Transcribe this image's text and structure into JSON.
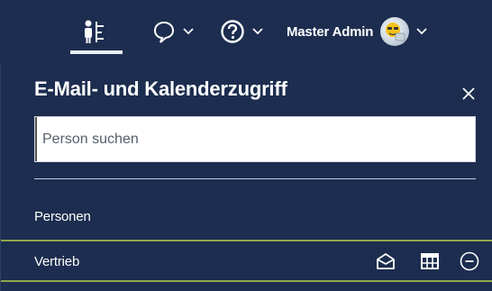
{
  "topbar": {
    "icons": [
      "people-directory-icon",
      "chat-bubble-icon",
      "help-icon",
      "chevron-down-icon"
    ],
    "user_name": "Master Admin",
    "accent_underline": "#e9eef5"
  },
  "panel": {
    "title": "E-Mail- und Kalenderzugriff",
    "close_icon": "close-icon",
    "search_placeholder": "Person suchen",
    "section_label": "Personen",
    "groups": [
      {
        "name": "Vertrieb",
        "actions": [
          "mail-open-icon",
          "calendar-grid-icon",
          "remove-circle-icon"
        ]
      }
    ]
  },
  "colors": {
    "background": "#1c2d4f",
    "row_border": "#8ea84a",
    "text": "#ffffff"
  }
}
